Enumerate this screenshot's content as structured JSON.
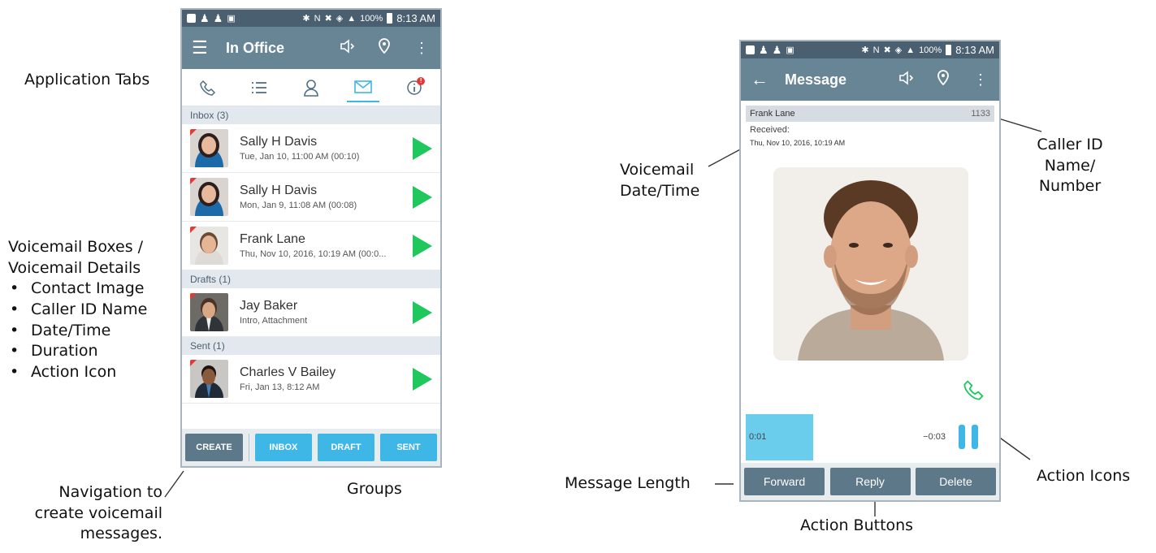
{
  "left_phone": {
    "status": {
      "battery": "100%",
      "time": "8:13 AM"
    },
    "appbar": {
      "title": "In Office"
    },
    "groups": [
      {
        "header": "Inbox (3)",
        "items": [
          {
            "name": "Sally H Davis",
            "detail": "Tue, Jan 10, 11:00 AM (00:10)"
          },
          {
            "name": "Sally H Davis",
            "detail": "Mon, Jan 9, 11:08 AM (00:08)"
          },
          {
            "name": "Frank Lane",
            "detail": "Thu, Nov 10, 2016, 10:19 AM (00:0..."
          }
        ]
      },
      {
        "header": "Drafts (1)",
        "items": [
          {
            "name": "Jay Baker",
            "detail": "Intro, Attachment"
          }
        ]
      },
      {
        "header": "Sent (1)",
        "items": [
          {
            "name": "Charles V Bailey",
            "detail": "Fri, Jan 13, 8:12 AM"
          }
        ]
      }
    ],
    "bottom_nav": {
      "create": "CREATE",
      "inbox": "INBOX",
      "draft": "DRAFT",
      "sent": "SENT"
    }
  },
  "right_phone": {
    "status": {
      "battery": "100%",
      "time": "8:13 AM"
    },
    "appbar": {
      "title": "Message"
    },
    "caller": {
      "name": "Frank Lane",
      "number": "1133"
    },
    "received": {
      "label": "Received:",
      "datetime": "Thu, Nov 10, 2016, 10:19 AM"
    },
    "player": {
      "elapsed": "0:01",
      "remaining": "−0:03",
      "progress_fraction": 0.27
    },
    "actions": {
      "forward": "Forward",
      "reply": "Reply",
      "delete": "Delete"
    }
  },
  "callouts": {
    "application_tabs": "Application Tabs",
    "voicemail_boxes": {
      "line1": "Voicemail Boxes /",
      "line2": "Voicemail Details"
    },
    "details_list": [
      "Contact Image",
      "Caller ID Name",
      "Date/Time",
      "Duration",
      "Action Icon"
    ],
    "navigation": {
      "line1": "Navigation to",
      "line2": "create voicemail",
      "line3": "messages."
    },
    "groups": "Groups",
    "voicemail_datetime": {
      "line1": "Voicemail",
      "line2": "Date/Time"
    },
    "caller_id": {
      "line1": "Caller ID",
      "line2": "Name/",
      "line3": "Number"
    },
    "message_length": "Message Length",
    "action_buttons": "Action Buttons",
    "action_icons": "Action Icons"
  },
  "colors": {
    "status_bar": "#4a5f70",
    "app_bar": "#688596",
    "accent_blue": "#3eb6e6",
    "play_green": "#1ec85c",
    "create_button": "#5d7888",
    "badge_red": "#e53935"
  }
}
